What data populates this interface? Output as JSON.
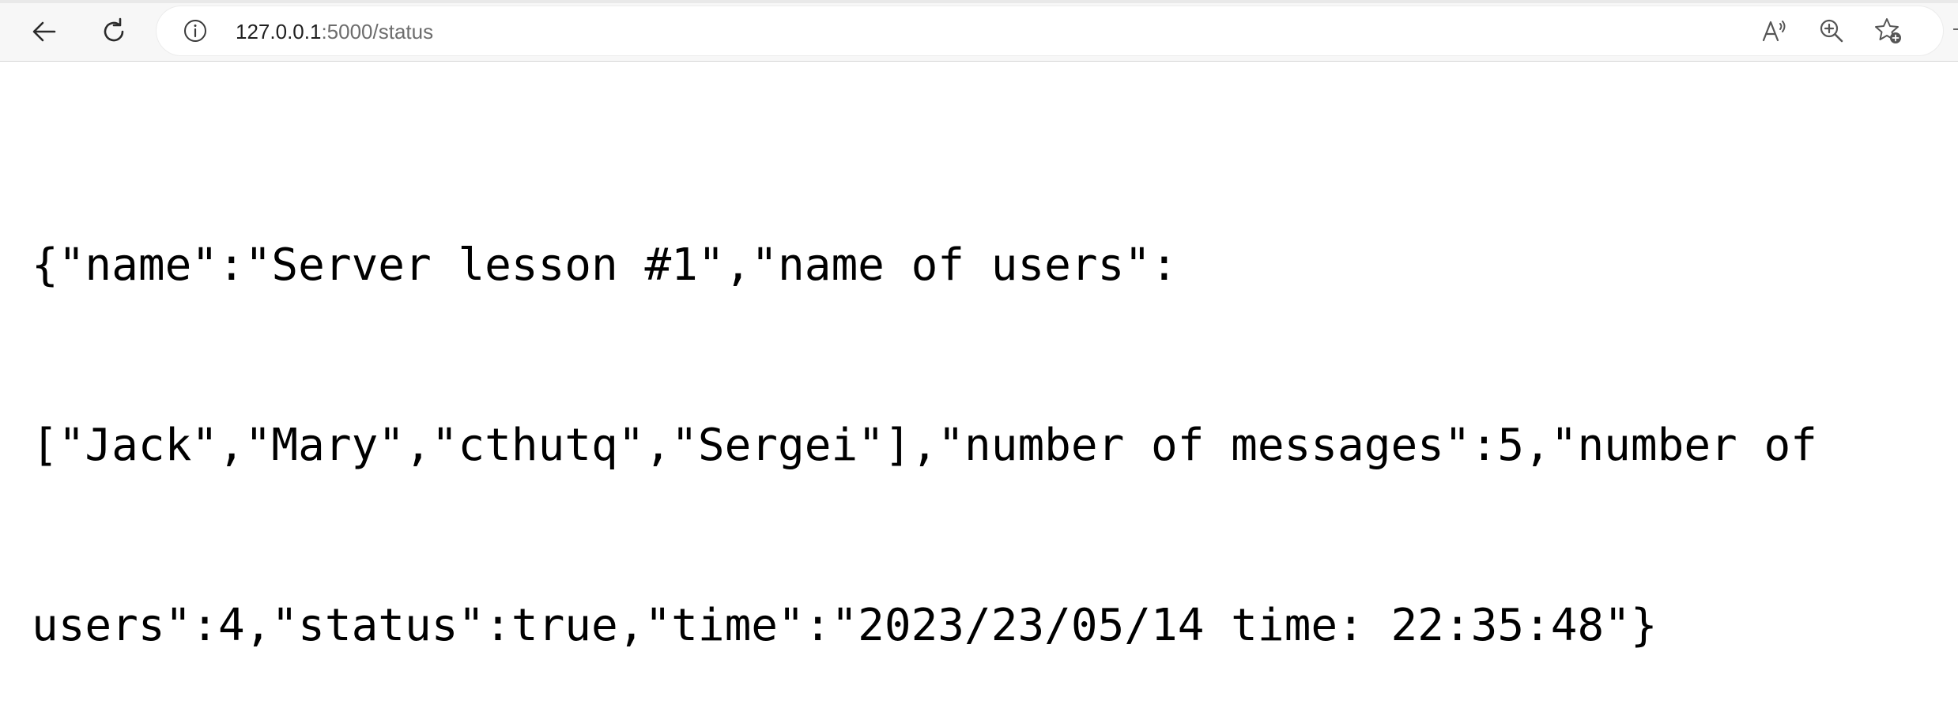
{
  "browser": {
    "url_host": "127.0.0.1",
    "url_rest": ":5000/status",
    "icons": {
      "back": "back-arrow-icon",
      "reload": "reload-icon",
      "site_info": "info-icon",
      "read_aloud": "read-aloud-icon",
      "zoom": "zoom-in-icon",
      "favorite": "add-favorite-icon"
    }
  },
  "content": {
    "lines": [
      "{\"name\":\"Server lesson #1\",\"name of users\":",
      "[\"Jack\",\"Mary\",\"cthutq\",\"Sergei\"],\"number of messages\":5,\"number of",
      "users\":4,\"status\":true,\"time\":\"2023/23/05/14 time: 22:35:48\"}"
    ]
  },
  "colors": {
    "toolbar_bg": "#f7f7f7",
    "page_bg": "#ffffff",
    "text": "#000000",
    "url_path": "#6d6d6d"
  }
}
